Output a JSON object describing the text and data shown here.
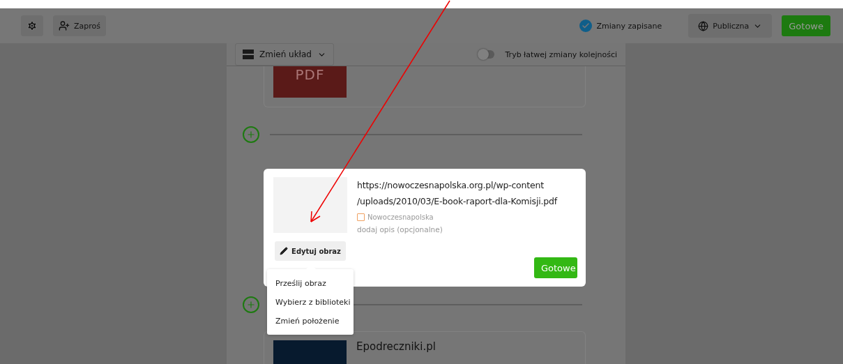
{
  "toolbar": {
    "invite_label": "Zaproś",
    "save_status": "Zmiany zapisane",
    "visibility": "Publiczna",
    "done_label": "Gotowe"
  },
  "layout_bar": {
    "layout_label": "Zmień układ",
    "easy_reorder": {
      "label": "Tryb łatwej zmiany kolejności",
      "on": false
    }
  },
  "cards": [
    {
      "kind": "pdf",
      "badge": "PDF"
    },
    {
      "kind": "image",
      "title": "Epodreczniki.pl"
    }
  ],
  "edit_dialog": {
    "title": "https://nowoczesnapolska.org.pl/wp-content\n/uploads/2010/03/E-book-raport-dla-Komisji.pdf",
    "source": "Nowoczesnapolska",
    "description_placeholder": "dodaj opis (opcjonalne)",
    "edit_image_label": "Edytuj obraz",
    "done_label": "Gotowe"
  },
  "image_menu": {
    "items": [
      {
        "label": "Prześlij obraz"
      },
      {
        "label": "Wybierz z biblioteki"
      },
      {
        "label": "Zmień położenie"
      }
    ]
  }
}
